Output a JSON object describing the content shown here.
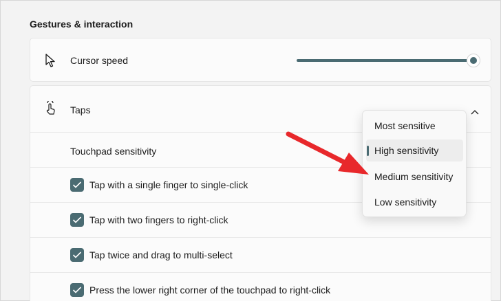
{
  "section": {
    "title": "Gestures & interaction"
  },
  "cursor": {
    "label": "Cursor speed",
    "icon": "cursor-arrow-icon",
    "slider_value_fraction": 1.0
  },
  "taps": {
    "label": "Taps",
    "icon": "tap-hand-icon",
    "expanded": true,
    "sensitivity_label": "Touchpad sensitivity",
    "options": [
      {
        "label": "Tap with a single finger to single-click",
        "checked": true
      },
      {
        "label": "Tap with two fingers to right-click",
        "checked": true
      },
      {
        "label": "Tap twice and drag to multi-select",
        "checked": true
      },
      {
        "label": "Press the lower right corner of the touchpad to right-click",
        "checked": true
      }
    ]
  },
  "sensitivity_menu": {
    "items": [
      {
        "label": "Most sensitive"
      },
      {
        "label": "High sensitivity",
        "selected": true
      },
      {
        "label": "Medium sensitivity"
      },
      {
        "label": "Low sensitivity"
      }
    ]
  },
  "colors": {
    "accent": "#4a6b72",
    "annotation_arrow": "#e8282b"
  }
}
